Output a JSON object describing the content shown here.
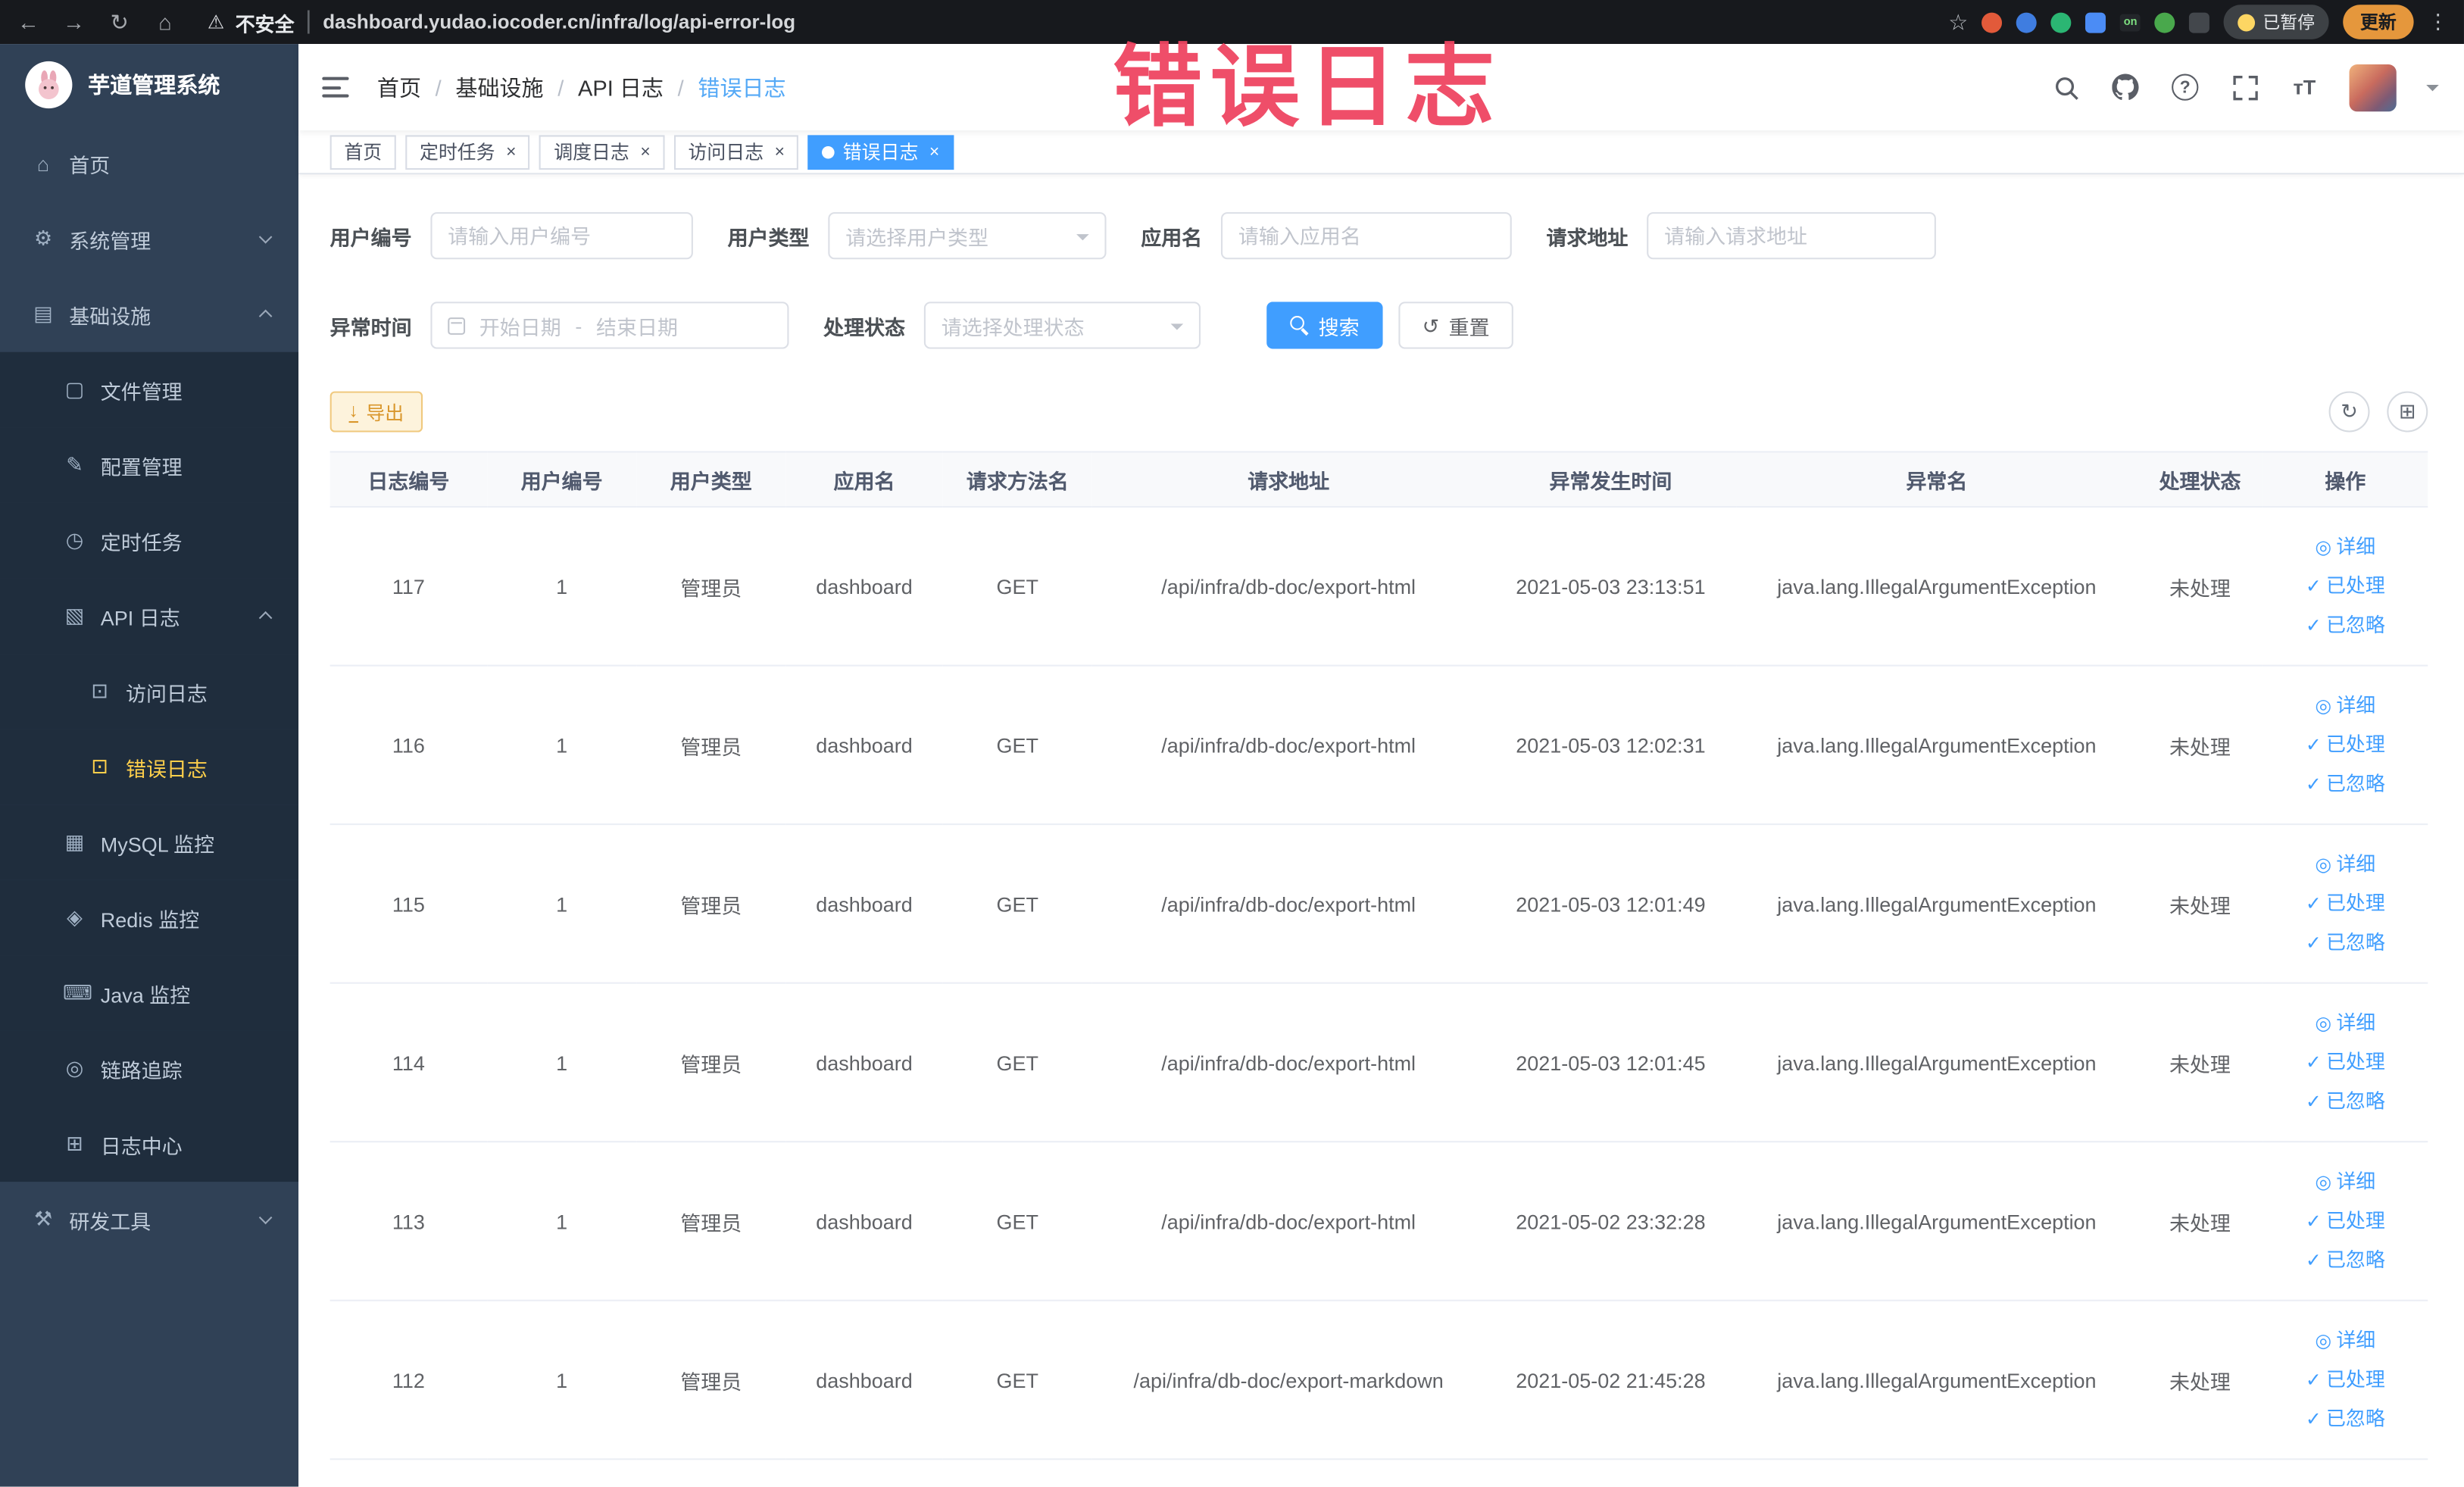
{
  "browser": {
    "security_label": "不安全",
    "url": "dashboard.yudao.iocoder.cn/infra/log/api-error-log",
    "paused_badge": "已暂停",
    "update_button": "更新"
  },
  "annotation": {
    "watermark": "错误日志"
  },
  "sidebar": {
    "logo_title": "芋道管理系统",
    "menu": [
      {
        "id": "home",
        "label": "首页",
        "icon": "home-icon",
        "glyph": "⌂",
        "level": 1
      },
      {
        "id": "system-management",
        "label": "系统管理",
        "icon": "gear-icon",
        "glyph": "⚙",
        "level": 1,
        "arrow": "down"
      },
      {
        "id": "infrastructure",
        "label": "基础设施",
        "icon": "infrastructure-icon",
        "glyph": "▤",
        "level": 1,
        "arrow": "up"
      },
      {
        "id": "file-management",
        "label": "文件管理",
        "icon": "file-icon",
        "glyph": "▢",
        "level": 2
      },
      {
        "id": "config-management",
        "label": "配置管理",
        "icon": "config-icon",
        "glyph": "✎",
        "level": 2
      },
      {
        "id": "scheduled-tasks",
        "label": "定时任务",
        "icon": "timer-icon",
        "glyph": "◷",
        "level": 2
      },
      {
        "id": "api-log",
        "label": "API 日志",
        "icon": "api-log-icon",
        "glyph": "▧",
        "level": 2,
        "arrow": "up"
      },
      {
        "id": "access-log",
        "label": "访问日志",
        "icon": "access-log-icon",
        "glyph": "⊡",
        "level": 3
      },
      {
        "id": "error-log",
        "label": "错误日志",
        "icon": "error-log-icon",
        "glyph": "⊡",
        "level": 3,
        "active": true
      },
      {
        "id": "mysql-monitor",
        "label": "MySQL 监控",
        "icon": "mysql-icon",
        "glyph": "▦",
        "level": 2
      },
      {
        "id": "redis-monitor",
        "label": "Redis 监控",
        "icon": "redis-icon",
        "glyph": "◈",
        "level": 2
      },
      {
        "id": "java-monitor",
        "label": "Java 监控",
        "icon": "java-icon",
        "glyph": "⌨",
        "level": 2
      },
      {
        "id": "trace",
        "label": "链路追踪",
        "icon": "trace-icon",
        "glyph": "◎",
        "level": 2
      },
      {
        "id": "log-center",
        "label": "日志中心",
        "icon": "log-center-icon",
        "glyph": "⊞",
        "level": 2
      },
      {
        "id": "dev-tools",
        "label": "研发工具",
        "icon": "devtools-icon",
        "glyph": "⚒",
        "level": 1,
        "arrow": "down"
      }
    ]
  },
  "navbar": {
    "breadcrumb": [
      "首页",
      "基础设施",
      "API 日志",
      "错误日志"
    ]
  },
  "tags": [
    {
      "id": "home",
      "label": "首页",
      "closable": false,
      "active": false
    },
    {
      "id": "scheduled-tasks",
      "label": "定时任务",
      "closable": true,
      "active": false
    },
    {
      "id": "schedule-log",
      "label": "调度日志",
      "closable": true,
      "active": false
    },
    {
      "id": "access-log",
      "label": "访问日志",
      "closable": true,
      "active": false
    },
    {
      "id": "error-log",
      "label": "错误日志",
      "closable": true,
      "active": true
    }
  ],
  "filters": {
    "user_id_label": "用户编号",
    "user_id_placeholder": "请输入用户编号",
    "user_type_label": "用户类型",
    "user_type_placeholder": "请选择用户类型",
    "app_name_label": "应用名",
    "app_name_placeholder": "请输入应用名",
    "request_url_label": "请求地址",
    "request_url_placeholder": "请输入请求地址",
    "exception_time_label": "异常时间",
    "start_date_placeholder": "开始日期",
    "range_separator": "-",
    "end_date_placeholder": "结束日期",
    "process_status_label": "处理状态",
    "process_status_placeholder": "请选择处理状态",
    "search_button": "搜索",
    "reset_button": "重置"
  },
  "toolbar": {
    "export_label": "导出"
  },
  "table": {
    "headers": [
      "日志编号",
      "用户编号",
      "用户类型",
      "应用名",
      "请求方法名",
      "请求地址",
      "异常发生时间",
      "异常名",
      "处理状态",
      "操作"
    ],
    "action_labels": {
      "detail": "详细",
      "processed": "已处理",
      "ignored": "已忽略"
    },
    "rows": [
      {
        "log_id": "117",
        "user_id": "1",
        "user_type": "管理员",
        "app_name": "dashboard",
        "method": "GET",
        "url": "/api/infra/db-doc/export-html",
        "time": "2021-05-03 23:13:51",
        "exception": "java.lang.IllegalArgumentException",
        "status": "未处理"
      },
      {
        "log_id": "116",
        "user_id": "1",
        "user_type": "管理员",
        "app_name": "dashboard",
        "method": "GET",
        "url": "/api/infra/db-doc/export-html",
        "time": "2021-05-03 12:02:31",
        "exception": "java.lang.IllegalArgumentException",
        "status": "未处理"
      },
      {
        "log_id": "115",
        "user_id": "1",
        "user_type": "管理员",
        "app_name": "dashboard",
        "method": "GET",
        "url": "/api/infra/db-doc/export-html",
        "time": "2021-05-03 12:01:49",
        "exception": "java.lang.IllegalArgumentException",
        "status": "未处理"
      },
      {
        "log_id": "114",
        "user_id": "1",
        "user_type": "管理员",
        "app_name": "dashboard",
        "method": "GET",
        "url": "/api/infra/db-doc/export-html",
        "time": "2021-05-03 12:01:45",
        "exception": "java.lang.IllegalArgumentException",
        "status": "未处理"
      },
      {
        "log_id": "113",
        "user_id": "1",
        "user_type": "管理员",
        "app_name": "dashboard",
        "method": "GET",
        "url": "/api/infra/db-doc/export-html",
        "time": "2021-05-02 23:32:28",
        "exception": "java.lang.IllegalArgumentException",
        "status": "未处理"
      },
      {
        "log_id": "112",
        "user_id": "1",
        "user_type": "管理员",
        "app_name": "dashboard",
        "method": "GET",
        "url": "/api/infra/db-doc/export-markdown",
        "time": "2021-05-02 21:45:28",
        "exception": "java.lang.IllegalArgumentException",
        "status": "未处理"
      }
    ]
  },
  "colors": {
    "primary": "#409eff",
    "warning": "#e6a23c",
    "menu_active": "#ffd04b",
    "watermark": "#ef4561"
  }
}
